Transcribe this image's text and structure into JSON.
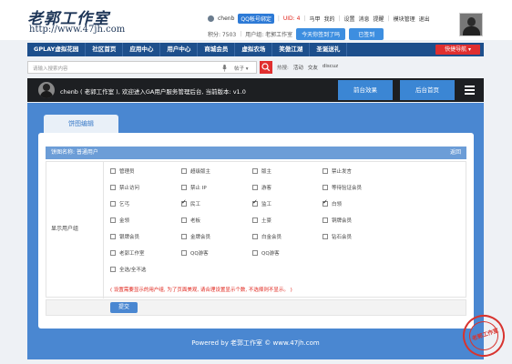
{
  "site": {
    "logo_main": "老郭工作室",
    "logo_url": "http://www.47jh.com"
  },
  "user": {
    "name": "chenb",
    "qq_bind": "QQ帐号绑定",
    "uid": "UID: 4",
    "links": [
      "马甲",
      "我的",
      "设置",
      "消息",
      "提醒",
      "模块管理",
      "退出"
    ],
    "points_label": "积分: 7503",
    "group_label": "用户组: 老郭工作室",
    "sign_prompt": "今天你签到了吗",
    "signed_button": "已签到"
  },
  "nav": {
    "items": [
      "GPLAY虚拟花园",
      "社区首页",
      "应用中心",
      "用户中心",
      "商城会员",
      "虚拟农场",
      "笑傲江湖",
      "圣诞送礼"
    ],
    "quick_nav": "快捷导航"
  },
  "search": {
    "placeholder": "请输入搜索内容",
    "type": "帖子",
    "hot_label": "热搜:",
    "hot_items": [
      "活动",
      "交友",
      "discuz"
    ]
  },
  "admin": {
    "welcome": "chenb ( 老郭工作室 ), 欢迎进入GA用户服务管理后台, 当前版本: v1.0",
    "btn_front": "前台效果",
    "btn_home": "后台首页"
  },
  "editor": {
    "tab": "饼图编辑",
    "panel_title": "饼图名称: 普通用户",
    "back": "返回",
    "field_label": "显示用户组",
    "options": [
      {
        "label": "管理员",
        "checked": false
      },
      {
        "label": "超级版主",
        "checked": false
      },
      {
        "label": "版主",
        "checked": false
      },
      {
        "label": "禁止发言",
        "checked": false
      },
      {
        "label": "禁止访问",
        "checked": false
      },
      {
        "label": "禁止 IP",
        "checked": false
      },
      {
        "label": "游客",
        "checked": false
      },
      {
        "label": "等待验证会员",
        "checked": false
      },
      {
        "label": "乞丐",
        "checked": false
      },
      {
        "label": "民工",
        "checked": true
      },
      {
        "label": "监工",
        "checked": true
      },
      {
        "label": "白领",
        "checked": true
      },
      {
        "label": "金领",
        "checked": false
      },
      {
        "label": "老板",
        "checked": false
      },
      {
        "label": "土豪",
        "checked": false
      },
      {
        "label": "铜牌会员",
        "checked": false
      },
      {
        "label": "银牌会员",
        "checked": false
      },
      {
        "label": "金牌会员",
        "checked": false
      },
      {
        "label": "白金会员",
        "checked": false
      },
      {
        "label": "钻石会员",
        "checked": false
      },
      {
        "label": "老郭工作室",
        "checked": false
      },
      {
        "label": "QQ游客",
        "checked": false
      },
      {
        "label": "QQ游客",
        "checked": false
      }
    ],
    "select_all": "全选/全不选",
    "note": "( 设置需要显示的用户组, 为了页面美观, 请合理设置显示个数, 不选择则不显示。 )",
    "submit": "提交"
  },
  "footer": "Powered by 老郭工作室 © www.47jh.com",
  "seal_text": "老郭工作室"
}
